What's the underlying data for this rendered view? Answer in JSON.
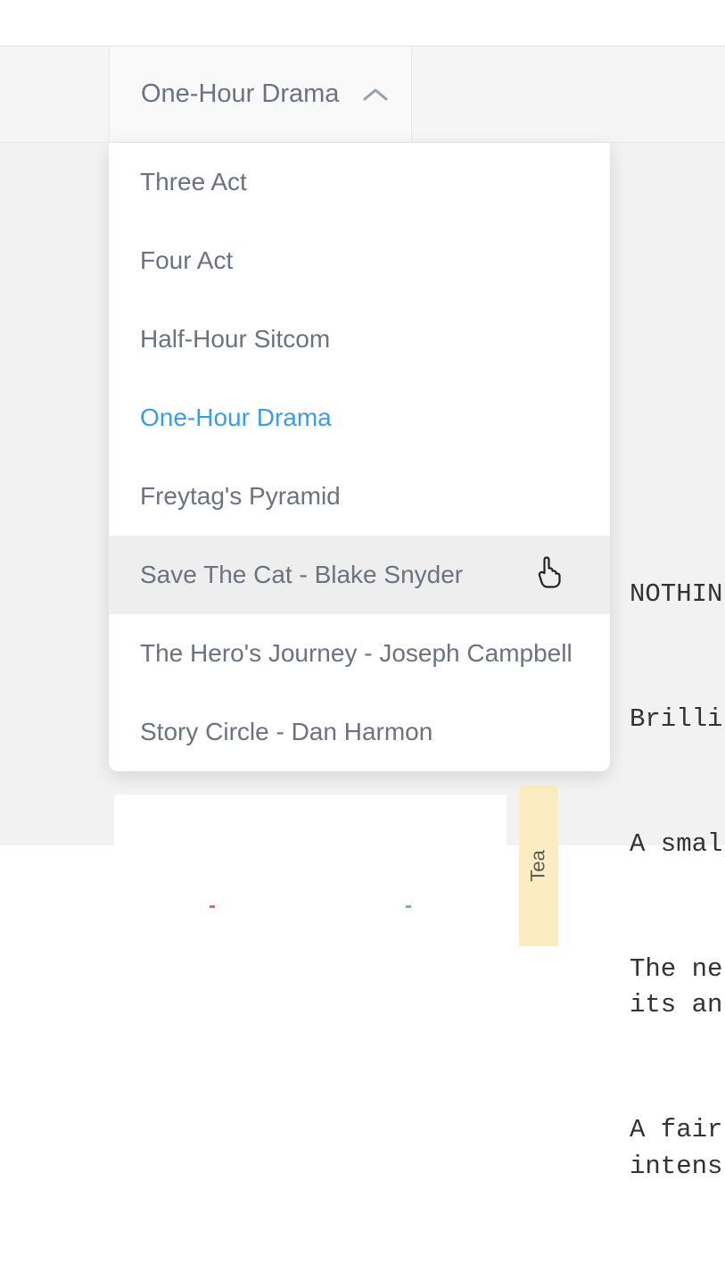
{
  "dropdown": {
    "current_label": "One-Hour Drama",
    "items": [
      {
        "label": "Three Act",
        "selected": false,
        "hovered": false
      },
      {
        "label": "Four Act",
        "selected": false,
        "hovered": false
      },
      {
        "label": "Half-Hour Sitcom",
        "selected": false,
        "hovered": false
      },
      {
        "label": "One-Hour Drama",
        "selected": true,
        "hovered": false
      },
      {
        "label": "Freytag's Pyramid",
        "selected": false,
        "hovered": false
      },
      {
        "label": "Save The Cat - Blake Snyder",
        "selected": false,
        "hovered": true
      },
      {
        "label": "The Hero's Journey - Joseph Campbell",
        "selected": false,
        "hovered": false
      },
      {
        "label": "Story Circle - Dan Harmon",
        "selected": false,
        "hovered": false
      }
    ]
  },
  "script": {
    "line1": "NOTHIN",
    "line2": "Brilli",
    "line3": "A smal",
    "line4": "The ne\nits an",
    "line5": "A fair\nintens"
  },
  "tag": {
    "teaser": "Tea"
  },
  "markers": {
    "red": "-",
    "green": "-"
  }
}
